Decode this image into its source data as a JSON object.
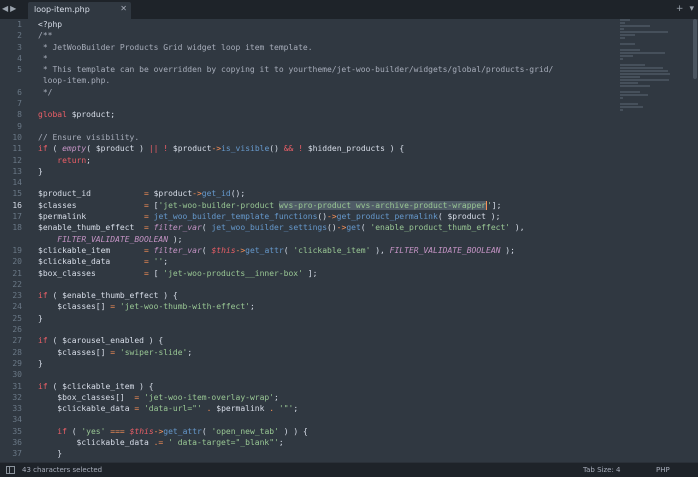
{
  "tabbar": {
    "nav_back": "◀",
    "nav_forward": "▶",
    "tab_label": "loop-item.php",
    "tab_close": "✕",
    "new_tab": "+",
    "menu": "▾"
  },
  "editor": {
    "active_line": 16,
    "line_numbers": [
      "1",
      "2",
      "3",
      "4",
      "5",
      "",
      "6",
      "7",
      "8",
      "9",
      "10",
      "11",
      "12",
      "13",
      "14",
      "15",
      "16",
      "17",
      "18",
      "",
      "19",
      "20",
      "21",
      "22",
      "23",
      "24",
      "25",
      "26",
      "27",
      "28",
      "29",
      "30",
      "31",
      "32",
      "33",
      "34",
      "35",
      "36",
      "37"
    ]
  },
  "statusbar": {
    "selection": "43 characters selected",
    "tab_size": "Tab Size: 4",
    "syntax": "PHP"
  },
  "colors": {
    "background": "#303841",
    "keyword": "#ec5f67",
    "function": "#6699cc",
    "string": "#99c794",
    "operator": "#f99157",
    "constant": "#c594c5",
    "comment": "#a7adba"
  }
}
